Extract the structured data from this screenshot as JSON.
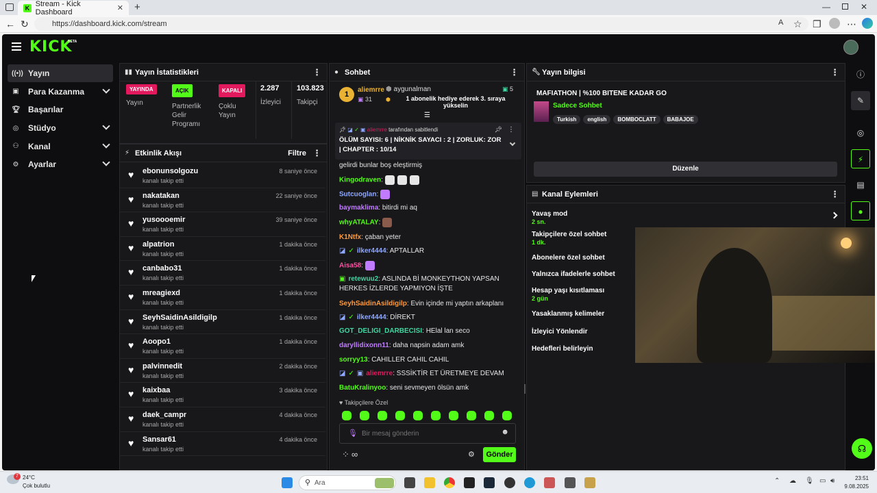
{
  "browser": {
    "tab_title": "Stream - Kick Dashboard",
    "url": "https://dashboard.kick.com/stream"
  },
  "brand": {
    "logo": "KICK",
    "beta": "BETA",
    "accent": "#53fc18"
  },
  "sidebar": {
    "items": [
      {
        "label": "Yayın",
        "icon": "broadcast-icon"
      },
      {
        "label": "Para Kazanma",
        "icon": "money-icon"
      },
      {
        "label": "Başarılar",
        "icon": "trophy-icon"
      },
      {
        "label": "Stüdyo",
        "icon": "studio-icon"
      },
      {
        "label": "Kanal",
        "icon": "channel-icon"
      },
      {
        "label": "Ayarlar",
        "icon": "gear-icon"
      }
    ]
  },
  "stats": {
    "title": "Yayın İstatistikleri",
    "items": [
      {
        "badge": "YAYINDA",
        "label": "Yayın"
      },
      {
        "badge": "AÇIK",
        "label": "Partnerlik Gelir Programı"
      },
      {
        "badge": "KAPALI",
        "label": "Çoklu Yayın"
      },
      {
        "value": "2.287",
        "label": "İzleyici"
      },
      {
        "value": "103.823",
        "label": "Takipçi"
      }
    ]
  },
  "activity": {
    "title": "Etkinlik Akışı",
    "filter": "Filtre",
    "rows": [
      {
        "name": "ebonunsolgozu",
        "sub": "kanalı takip etti",
        "time": "8 saniye önce"
      },
      {
        "name": "nakatakan",
        "sub": "kanalı takip etti",
        "time": "22 saniye önce"
      },
      {
        "name": "yusoooemir",
        "sub": "kanalı takip etti",
        "time": "39 saniye önce"
      },
      {
        "name": "alpatrion",
        "sub": "kanalı takip etti",
        "time": "1 dakika önce"
      },
      {
        "name": "canbabo31",
        "sub": "kanalı takip etti",
        "time": "1 dakika önce"
      },
      {
        "name": "mreagiexd",
        "sub": "kanalı takip etti",
        "time": "1 dakika önce"
      },
      {
        "name": "SeyhSaidinAsildigilp",
        "sub": "kanalı takip etti",
        "time": "1 dakika önce"
      },
      {
        "name": "Aoopo1",
        "sub": "kanalı takip etti",
        "time": "1 dakika önce"
      },
      {
        "name": "palvinnedit",
        "sub": "kanalı takip etti",
        "time": "2 dakika önce"
      },
      {
        "name": "kaixbaa",
        "sub": "kanalı takip etti",
        "time": "3 dakika önce"
      },
      {
        "name": "daek_campr",
        "sub": "kanalı takip etti",
        "time": "4 dakika önce"
      },
      {
        "name": "Sansar61",
        "sub": "kanalı takip etti",
        "time": "4 dakika önce"
      }
    ]
  },
  "chat": {
    "title": "Sohbet",
    "gift": {
      "rank": "1",
      "user": "aliemrre",
      "count": "31",
      "gifter": "aygunalman",
      "gifter_count": "5",
      "message": "1 abonelik hediye ederek 3. sıraya yükselin"
    },
    "pinned": {
      "by": "aliemrre",
      "by_suffix": "tarafından sabitlendi",
      "text": "ÖLÜM SAYISI: 6 | NİKNİK SAYACI : 2 | ZORLUK: ZOR | CHAPTER : 10/14"
    },
    "messages": [
      {
        "user": "",
        "text": "gelirdi bunlar boş eleştirmiş",
        "color": "#e6e6e6"
      },
      {
        "user": "Kingodraven",
        "text": "",
        "color": "#53fc18"
      },
      {
        "user": "Sutcuoglan",
        "text": "",
        "color": "#8fa8ff"
      },
      {
        "user": "baymaklima",
        "text": "bitirdi mi aq",
        "color": "#c07bff"
      },
      {
        "user": "whyATALAY",
        "text": "",
        "color": "#53fc18"
      },
      {
        "user": "K1Ntfx",
        "text": "çaban yeter",
        "color": "#ff9a3c"
      },
      {
        "user": "ilker4444",
        "text": "APTALLAR",
        "color": "#8fa8ff"
      },
      {
        "user": "Aisa58",
        "text": "",
        "color": "#ff4fa0"
      },
      {
        "user": "retewuu2",
        "text": "ASLINDA Bİ MONKEYTHON YAPSAN HERKES İZLERDE YAPMIYON İŞTE",
        "color": "#3fd6a0"
      },
      {
        "user": "SeyhSaidinAsildigilp",
        "text": "Evin içinde mi yaptın arkaplanı",
        "color": "#ff9a3c"
      },
      {
        "user": "ilker4444",
        "text": "DİREKT",
        "color": "#8fa8ff"
      },
      {
        "user": "GOT_DELIGI_DARBECISI",
        "text": "HElal lan seco",
        "color": "#3fd6a0"
      },
      {
        "user": "daryllidixonn11",
        "text": "daha napsin adam amk",
        "color": "#c07bff"
      },
      {
        "user": "sorryy13",
        "text": "CAHILLER CAHIL CAHIL",
        "color": "#53fc18"
      },
      {
        "user": "aliemrre",
        "text": "SSSİKTİR ET ÜRETMEYE DEVAM",
        "color": "#e2195c"
      },
      {
        "user": "BatuKralinyoo",
        "text": "seni sevmeyen ölsün amk",
        "color": "#53fc18"
      }
    ],
    "followers_only": "Takipçilere Özel",
    "input_placeholder": "Bir mesaj gönderin",
    "send": "Gönder",
    "infinity": "∞"
  },
  "stream_info": {
    "title": "Yayın bilgisi",
    "stream_title": "MAFIATHON | %100 BITENE KADAR GO",
    "category": "Sadece Sohbet",
    "tags": [
      "Turkish",
      "english",
      "BOMBOCLATT",
      "BABAJOE"
    ],
    "edit": "Düzenle"
  },
  "channel_actions": {
    "title": "Kanal Eylemleri",
    "items": [
      {
        "label": "Yavaş mod",
        "sub": "2 sn."
      },
      {
        "label": "Takipçilere özel sohbet",
        "sub": "1 dk."
      },
      {
        "label": "Abonelere özel sohbet",
        "sub": ""
      },
      {
        "label": "Yalnızca ifadelerle sohbet",
        "sub": ""
      },
      {
        "label": "Hesap yaşı kısıtlaması",
        "sub": "2 gün"
      },
      {
        "label": "Yasaklanmış kelimeler",
        "sub": ""
      },
      {
        "label": "İzleyici Yönlendir",
        "sub": ""
      },
      {
        "label": "Hedefleri belirleyin",
        "sub": ""
      }
    ]
  },
  "taskbar": {
    "weather_temp": "24°C",
    "weather_desc": "Çok bulutlu",
    "search": "Ara",
    "time": "23:51",
    "date": "9.08.2025",
    "weather_badge": "7"
  }
}
